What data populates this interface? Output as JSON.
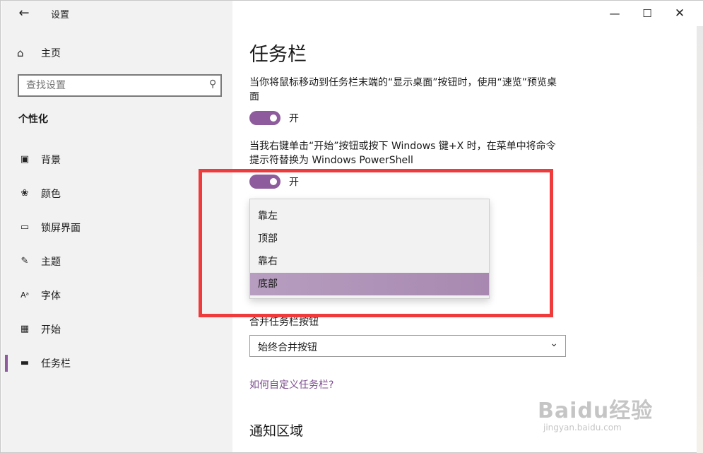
{
  "app": {
    "title": "设置",
    "back_icon": "back-arrow-icon"
  },
  "window_controls": {
    "minimize": "—",
    "maximize": "☐",
    "close": "✕"
  },
  "sidebar": {
    "home_label": "主页",
    "search_placeholder": "查找设置",
    "section": "个性化",
    "items": [
      {
        "label": "背景",
        "icon": "picture-icon"
      },
      {
        "label": "颜色",
        "icon": "palette-icon"
      },
      {
        "label": "锁屏界面",
        "icon": "lockscreen-icon"
      },
      {
        "label": "主题",
        "icon": "theme-icon"
      },
      {
        "label": "字体",
        "icon": "font-icon"
      },
      {
        "label": "开始",
        "icon": "start-icon"
      },
      {
        "label": "任务栏",
        "icon": "taskbar-icon",
        "active": true
      }
    ]
  },
  "main": {
    "title": "任务栏",
    "peek_desc": "当你将鼠标移动到任务栏末端的“显示桌面”按钮时，使用“速览”预览桌面",
    "peek_state": "开",
    "powershell_desc": "当我右键单击“开始”按钮或按下 Windows 键+X 时，在菜单中将命令提示符替换为 Windows PowerShell",
    "powershell_state": "开",
    "position_options": [
      "靠左",
      "顶部",
      "靠右",
      "底部"
    ],
    "position_selected": "底部",
    "combine_label": "合并任务栏按钮",
    "combine_value": "始终合并按钮",
    "help_link": "如何自定义任务栏?",
    "notify_title": "通知区域"
  },
  "watermark": {
    "logo": "Baidu经验",
    "url": "jingyan.baidu.com"
  },
  "colors": {
    "accent": "#8e5b9d",
    "annotation": "#ef3b3b",
    "sidebar_bg": "#f2f2f2"
  }
}
